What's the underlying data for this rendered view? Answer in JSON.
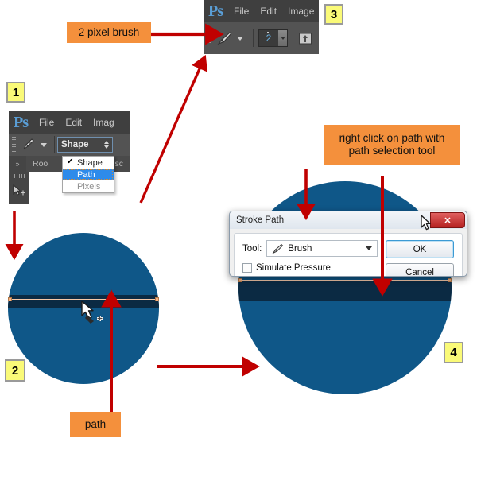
{
  "callouts": {
    "brush": "2 pixel brush",
    "right_click": "right click on path with\npath selection tool",
    "right_click_line1": "right click on path with",
    "right_click_line2": "path selection tool",
    "path": "path"
  },
  "badges": [
    {
      "id": "step-1",
      "label": "1"
    },
    {
      "id": "step-2",
      "label": "2"
    },
    {
      "id": "step-3",
      "label": "3"
    },
    {
      "id": "step-4",
      "label": "4"
    }
  ],
  "photoshop_brush_panel": {
    "logo": "Ps",
    "menu": [
      "File",
      "Edit",
      "Image"
    ],
    "brush_size_value": "2",
    "brush_icon": "brush-icon",
    "preset_icon": "brush-preset-icon",
    "airbrush_icon": "airbrush-icon"
  },
  "photoshop_pen_panel": {
    "logo": "Ps",
    "menu": [
      "File",
      "Edit",
      "Imag"
    ],
    "tool_icon": "pen-tool-icon",
    "mode_combo_value": "Shape",
    "mode_options": [
      {
        "label": "Shape",
        "checked": true,
        "selected": false,
        "dim": false
      },
      {
        "label": "Path",
        "checked": false,
        "selected": true,
        "dim": false
      },
      {
        "label": "Pixels",
        "checked": false,
        "selected": false,
        "dim": true
      }
    ],
    "document_tab": "Roo",
    "document_tab_tail": "sc",
    "panel_tool_icon": "path-selection-tool-icon"
  },
  "stroke_path_dialog": {
    "title": "Stroke Path",
    "close_label": "✕",
    "tool_label": "Tool:",
    "tool_value": "Brush",
    "tool_icon": "brush-icon",
    "simulate_pressure_label": "Simulate Pressure",
    "simulate_pressure_checked": false,
    "ok_label": "OK",
    "cancel_label": "Cancel"
  },
  "canvas": {
    "left_circle_label": "blue-circle-with-path",
    "right_circle_label": "blue-circle-stroked",
    "cursor_icon": "pen-tool-cursor",
    "colors": {
      "circle_blue": "#0F5788",
      "band_dark": "#0B2A43",
      "path_line": "#F6C8A8",
      "anchor": "#F4B183"
    }
  },
  "colors": {
    "callout_orange": "#F4903C",
    "badge_yellow": "#FAFA78",
    "arrow_red": "#C00000",
    "ps_dark": "#535353",
    "highlight_blue": "#2E8BEA"
  }
}
